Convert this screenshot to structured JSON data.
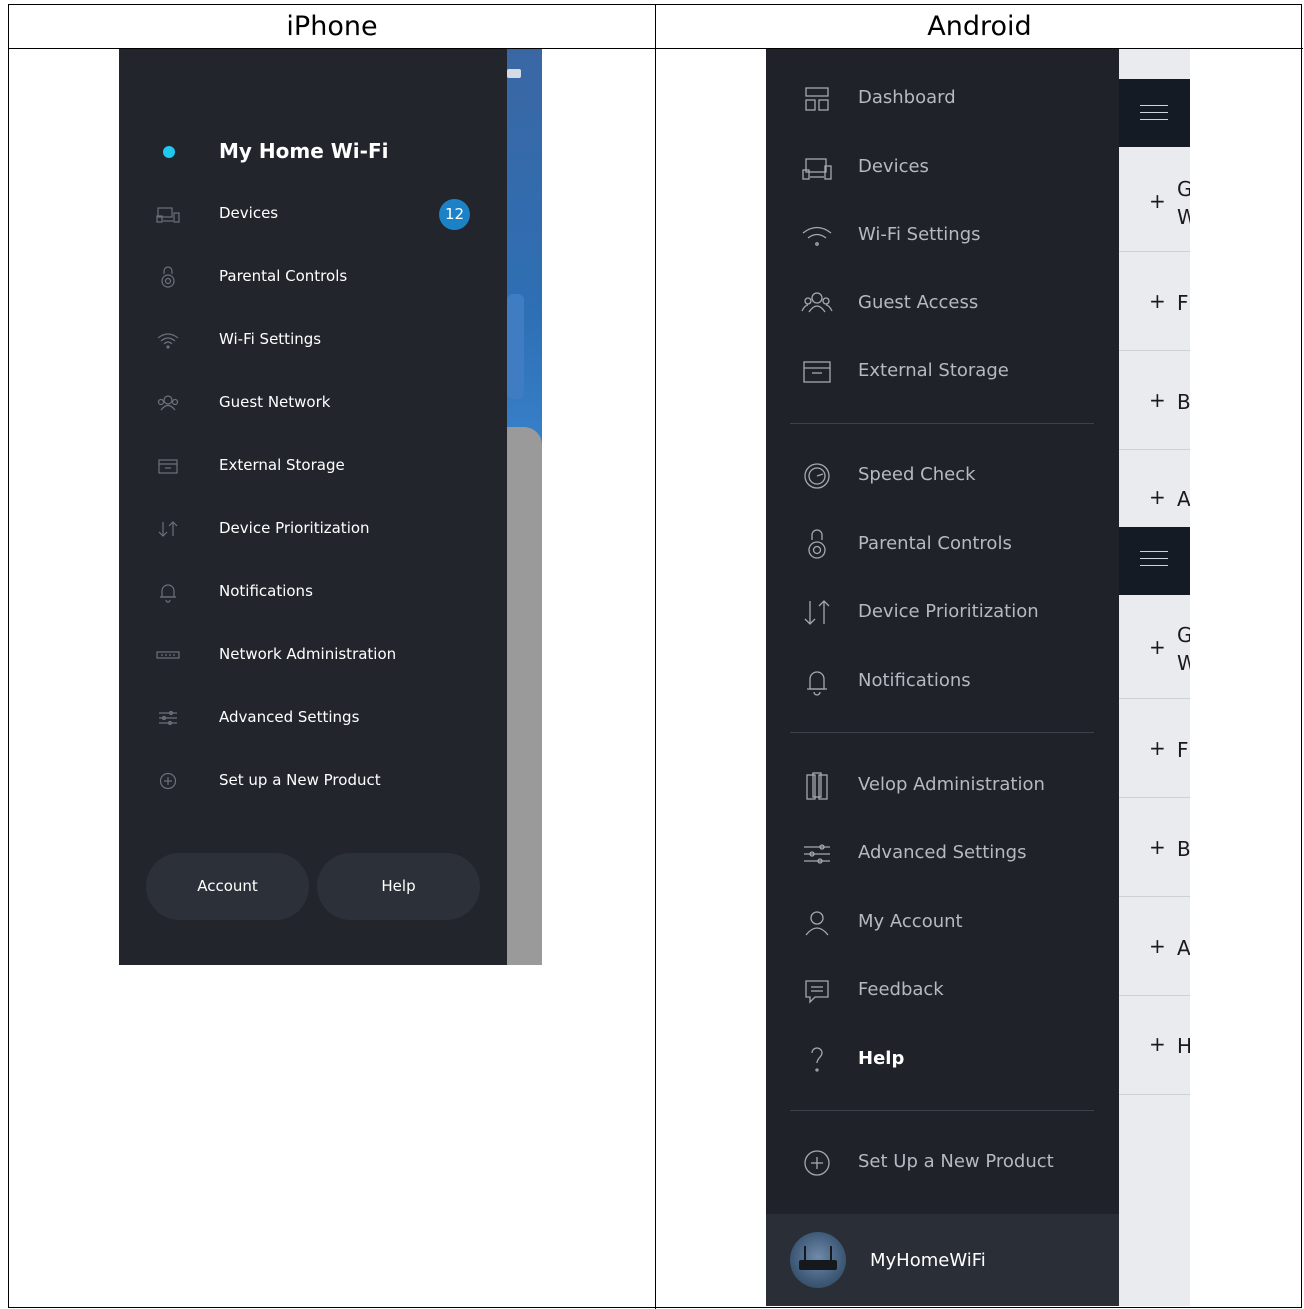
{
  "headers": {
    "iphone": "iPhone",
    "android": "Android"
  },
  "iphone": {
    "network_name": "My Home Wi-Fi",
    "items": [
      {
        "label": "Devices",
        "icon": "devices-icon",
        "badge": "12"
      },
      {
        "label": "Parental Controls",
        "icon": "lock-icon"
      },
      {
        "label": "Wi-Fi Settings",
        "icon": "wifi-icon"
      },
      {
        "label": "Guest Network",
        "icon": "guest-icon"
      },
      {
        "label": "External Storage",
        "icon": "storage-icon"
      },
      {
        "label": "Device Prioritization",
        "icon": "priority-icon"
      },
      {
        "label": "Notifications",
        "icon": "bell-icon"
      },
      {
        "label": "Network Administration",
        "icon": "router-icon"
      },
      {
        "label": "Advanced Settings",
        "icon": "sliders-icon"
      },
      {
        "label": "Set up a New Product",
        "icon": "plus-circle-icon"
      }
    ],
    "account_button": "Account",
    "help_button": "Help"
  },
  "android": {
    "items": [
      {
        "label": "Dashboard",
        "icon": "dashboard-icon"
      },
      {
        "label": "Devices",
        "icon": "devices-icon"
      },
      {
        "label": "Wi-Fi Settings",
        "icon": "wifi-icon"
      },
      {
        "label": "Guest Access",
        "icon": "guest-icon"
      },
      {
        "label": "External Storage",
        "icon": "storage-icon"
      },
      {
        "label": "Speed Check",
        "icon": "speedometer-icon"
      },
      {
        "label": "Parental Controls",
        "icon": "lock-icon"
      },
      {
        "label": "Device Prioritization",
        "icon": "priority-icon"
      },
      {
        "label": "Notifications",
        "icon": "bell-icon"
      },
      {
        "label": "Velop Administration",
        "icon": "velop-icon"
      },
      {
        "label": "Advanced Settings",
        "icon": "sliders-icon"
      },
      {
        "label": "My Account",
        "icon": "user-icon"
      },
      {
        "label": "Feedback",
        "icon": "feedback-icon"
      },
      {
        "label": "Help",
        "icon": "help-icon"
      },
      {
        "label": "Set Up a New Product",
        "icon": "plus-circle-icon"
      }
    ],
    "network_name": "MyHomeWiFi",
    "peek_rows": [
      {
        "plus": "+",
        "text": "G\nW"
      },
      {
        "plus": "+",
        "text": "F"
      },
      {
        "plus": "+",
        "text": "B"
      },
      {
        "plus": "+",
        "text": "A"
      },
      {
        "plus": "+",
        "text": "G\nW"
      },
      {
        "plus": "+",
        "text": "F"
      },
      {
        "plus": "+",
        "text": "B"
      },
      {
        "plus": "+",
        "text": "A"
      },
      {
        "plus": "+",
        "text": "H"
      }
    ]
  },
  "colors": {
    "menu_bg": "#22252c",
    "accent_dot": "#1ec8ef",
    "badge": "#1b82c8"
  }
}
